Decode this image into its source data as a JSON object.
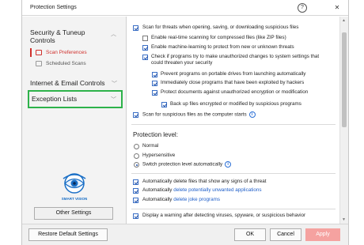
{
  "window": {
    "title": "Protection Settings",
    "help_label": "?",
    "close_label": "✕"
  },
  "sidebar": {
    "security_heading": "Security & Tuneup Controls",
    "items": [
      {
        "label": "Scan Preferences",
        "active": true
      },
      {
        "label": "Scheduled Scans",
        "active": false
      }
    ],
    "internet_heading": "Internet & Email Controls",
    "exception_heading": "Exception Lists",
    "other_settings": "Other Settings",
    "logo_text": "SMART VISION"
  },
  "options": {
    "scan_threats": "Scan for threats when opening, saving, or downloading suspicious files",
    "realtime_compressed": "Enable real-time scanning for compressed files (like ZIP files)",
    "machine_learning": "Enable machine-learning to protect from new or unknown threats",
    "check_programs_1": "Check if programs try to make unauthorized changes to system settings that",
    "check_programs_2": "could threaten your security",
    "prevent_portable": "Prevent programs on portable drives from launching automatically",
    "immediately_close": "Immediately close programs that have been exploited by hackers",
    "protect_documents": "Protect documents against unauthorized encryption or modification",
    "backup_files": "Back up files encrypted or modified by suspicious programs",
    "scan_startup": "Scan for suspicious files as the computer starts",
    "protection_level_label": "Protection level:",
    "levels": [
      "Normal",
      "Hypersensitive",
      "Switch protection level automatically"
    ],
    "auto_delete_threats": "Automatically delete files that show any signs of a threat",
    "auto_delete_pua_prefix": "Automatically ",
    "auto_delete_pua_link": "delete potentially unwanted applications",
    "auto_delete_joke_prefix": "Automatically ",
    "auto_delete_joke_link": "delete joke programs",
    "display_warning": "Display a warning after detecting viruses, spyware, or suspicious behavior"
  },
  "footer": {
    "restore": "Restore Default Settings",
    "ok": "OK",
    "cancel": "Cancel",
    "apply": "Apply"
  },
  "colors": {
    "accent_red": "#d0312d",
    "highlight_green": "#2db24a",
    "link_blue": "#1f5fc9"
  }
}
